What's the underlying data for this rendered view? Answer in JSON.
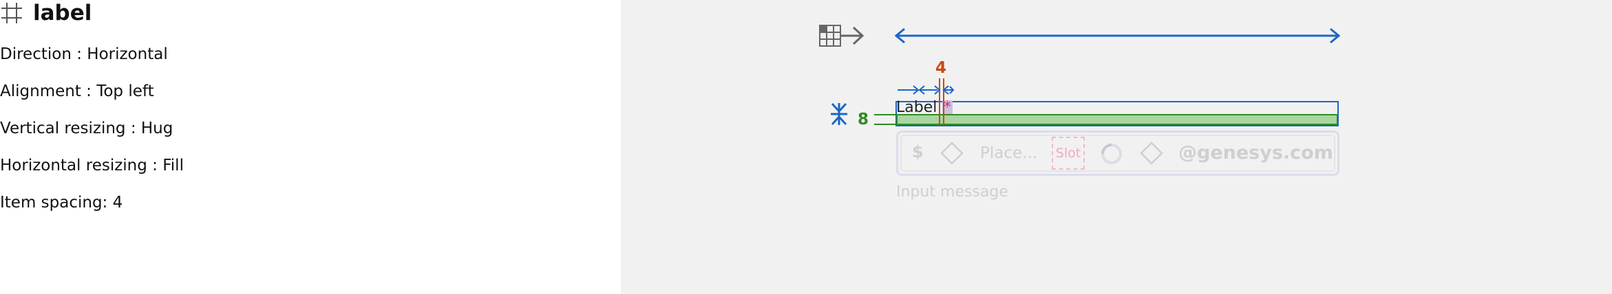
{
  "panel": {
    "title": "label",
    "properties": [
      {
        "name": "Direction",
        "sep": " : ",
        "value": "Horizontal",
        "text": "Direction : Horizontal"
      },
      {
        "name": "Alignment",
        "sep": " : ",
        "value": "Top left",
        "text": "Alignment : Top left"
      },
      {
        "name": "Vertical resizing",
        "sep": " : ",
        "value": "Hug",
        "text": "Vertical resizing : Hug"
      },
      {
        "name": "Horizontal resizing",
        "sep": " : ",
        "value": "Fill",
        "text": "Horizontal resizing : Fill"
      },
      {
        "name": "Item spacing",
        "sep": ": ",
        "value": "4",
        "text": "Item spacing: 4"
      }
    ]
  },
  "canvas": {
    "item_spacing_marker": "4",
    "padding_marker": "8",
    "label_text": "Label",
    "required_marker": "*",
    "ghost": {
      "prefix": "$",
      "placeholder": "Place...",
      "slot": "Slot",
      "suffix": "@genesys.com",
      "helper": "Input message"
    }
  },
  "colors": {
    "right_background": "#f1f1f1",
    "blue_guide": "#1a66c7",
    "orange_spacing": "#c84a0f",
    "green_padding": "#2e8b22",
    "green_fill": "#a9d6a1",
    "asterisk": "#e0277a"
  },
  "icons": {
    "title": "frame-hash-icon",
    "layout": "grid-arrow-icon",
    "vertical_hug": "vertical-hug-icon"
  }
}
